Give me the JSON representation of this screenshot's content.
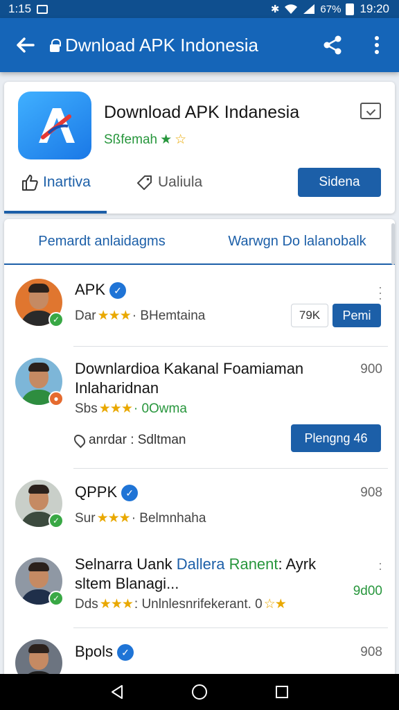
{
  "status_bar": {
    "time_left": "1:15",
    "battery": "67%",
    "time_right": "19:20"
  },
  "app_bar": {
    "title": "Dwnload APK Indonesia"
  },
  "header_card": {
    "app_name": "Download APK Indanesia",
    "rating_text": "Sßfemah",
    "action_1": "Inartiva",
    "action_2": "Ualiula",
    "primary_button": "Sidena"
  },
  "tabs": [
    "Pemardt anlaidagms",
    "Warwgn Do lalanobalk"
  ],
  "items": [
    {
      "name": "APK",
      "meta_prefix": "Dar",
      "stars": "★★★",
      "meta_suffix": "· BHemtaina",
      "chip": "79K",
      "button": "Pemi"
    },
    {
      "name_line1": "Downlardioa Kakanal Foamiaman",
      "name_line2": "Inlaharidnan",
      "meta_prefix": "Sbs",
      "stars": "★★★",
      "meta_suffix": "· 0Owma",
      "count": "900",
      "location": "anrdar : Sdltman",
      "button": "Plengng 46"
    },
    {
      "name": "QPPK",
      "meta_prefix": "Sur",
      "stars": "★★★",
      "meta_suffix": "· Belmnhaha",
      "count": "908"
    },
    {
      "name_a": "Selnarra Uank ",
      "name_b": "Dallera",
      "name_c": " Ranent",
      "name_d": ": Ayrk",
      "name_line2": "sltem Blanagi...",
      "meta_prefix": "Dds",
      "stars": "★★★",
      "meta_suffix": ": Unlnlesnrifekerant. 0",
      "count": "9d00"
    },
    {
      "name": "Bpols",
      "count": "908"
    }
  ],
  "colors": {
    "primary": "#1565b8",
    "accent": "#1c5fa8",
    "rating_green": "#27963c",
    "star": "#e9a800"
  }
}
